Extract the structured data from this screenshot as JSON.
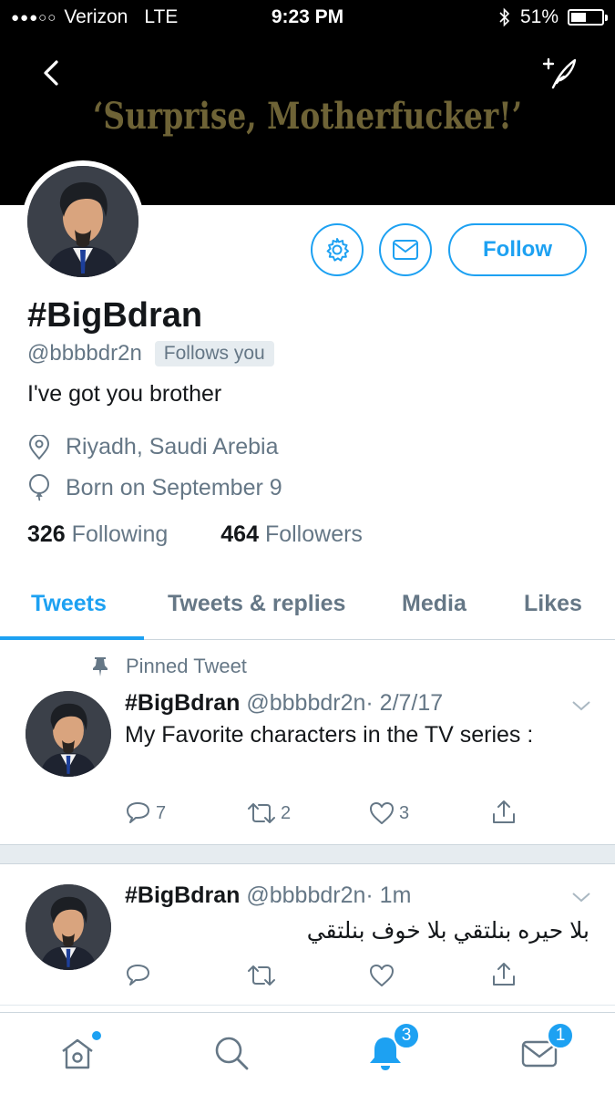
{
  "status_bar": {
    "signal": "●●●○○",
    "carrier": "Verizon",
    "network": "LTE",
    "time": "9:23 PM",
    "battery": "51%",
    "battery_level": 0.51
  },
  "banner": {
    "text": "‘Surprise, Motherfucker!’"
  },
  "profile": {
    "name": "#BigBdran",
    "handle": "@bbbbdr2n",
    "follows_you": "Follows you",
    "bio": "I've got you brother",
    "location": "Riyadh, Saudi Arebia",
    "birthday": "Born on September 9",
    "following_count": "326",
    "following_label": "Following",
    "followers_count": "464",
    "followers_label": "Followers"
  },
  "buttons": {
    "follow": "Follow"
  },
  "tabs": [
    {
      "label": "Tweets",
      "active": true
    },
    {
      "label": "Tweets & replies",
      "active": false
    },
    {
      "label": "Media",
      "active": false
    },
    {
      "label": "Likes",
      "active": false
    }
  ],
  "tweets": [
    {
      "pinned_label": "Pinned Tweet",
      "name": "#BigBdran",
      "handle": "@bbbbdr2n",
      "time": "· 2/7/17",
      "text": "My Favorite characters in the TV series :",
      "replies": "7",
      "retweets": "2",
      "likes": "3"
    },
    {
      "name": "#BigBdran",
      "handle": "@bbbbdr2n",
      "time": "· 1m",
      "text": "بلا حيره بنلتقي بلا خوف بنلتقي",
      "replies": "",
      "retweets": "",
      "likes": ""
    }
  ],
  "bottom_nav": {
    "notifications_badge": "3",
    "messages_badge": "1"
  },
  "colors": {
    "accent": "#1da1f2",
    "secondary_text": "#657786",
    "banner_text": "#6e6336"
  }
}
